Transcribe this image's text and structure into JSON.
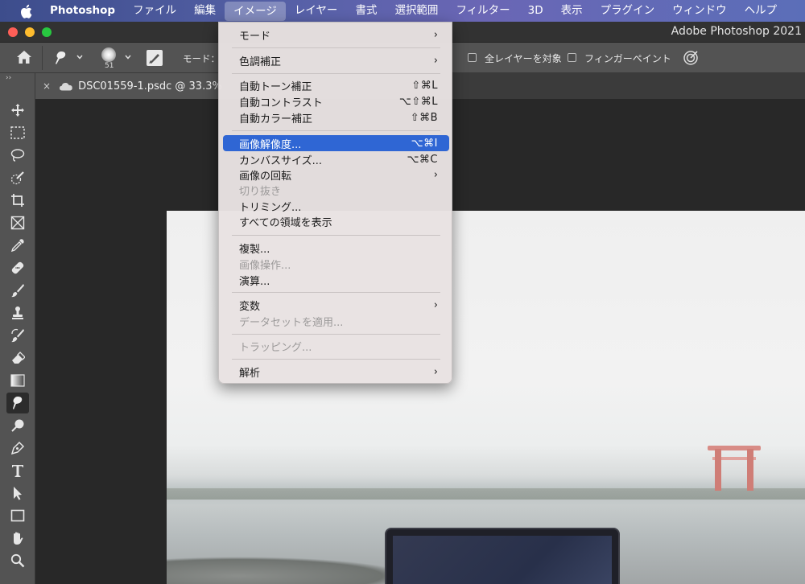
{
  "menubar": {
    "app": "Photoshop",
    "items": [
      "ファイル",
      "編集",
      "イメージ",
      "レイヤー",
      "書式",
      "選択範囲",
      "フィルター",
      "3D",
      "表示",
      "プラグイン",
      "ウィンドウ",
      "ヘルプ"
    ]
  },
  "window": {
    "title": "Adobe Photoshop 2021"
  },
  "options": {
    "brush_size": "51",
    "mode_label": "モード：",
    "all_layers_label": "全レイヤーを対象",
    "finger_paint_label": "フィンガーペイント"
  },
  "tab": {
    "title": "DSC01559-1.psdc @ 33.3%"
  },
  "toolbar": {
    "tools": [
      "move-tool",
      "marquee-tool",
      "lasso-tool",
      "quick-select-tool",
      "crop-tool",
      "frame-tool",
      "eyedropper-tool",
      "healing-brush-tool",
      "brush-tool",
      "clone-stamp-tool",
      "history-brush-tool",
      "eraser-tool",
      "gradient-tool",
      "smudge-tool",
      "dodge-tool",
      "pen-tool",
      "type-tool",
      "path-select-tool",
      "rectangle-tool",
      "hand-tool",
      "zoom-tool"
    ],
    "active": "smudge-tool"
  },
  "menu": {
    "items": [
      {
        "label": "モード",
        "shortcut": "",
        "submenu": true,
        "disabled": false
      },
      {
        "label": "色調補正",
        "shortcut": "",
        "submenu": true,
        "disabled": false
      },
      {
        "label": "自動トーン補正",
        "shortcut": "⇧⌘L",
        "submenu": false,
        "disabled": false
      },
      {
        "label": "自動コントラスト",
        "shortcut": "⌥⇧⌘L",
        "submenu": false,
        "disabled": false
      },
      {
        "label": "自動カラー補正",
        "shortcut": "⇧⌘B",
        "submenu": false,
        "disabled": false
      },
      {
        "label": "画像解像度...",
        "shortcut": "⌥⌘I",
        "submenu": false,
        "disabled": false,
        "highlighted": true
      },
      {
        "label": "カンバスサイズ...",
        "shortcut": "⌥⌘C",
        "submenu": false,
        "disabled": false
      },
      {
        "label": "画像の回転",
        "shortcut": "",
        "submenu": true,
        "disabled": false
      },
      {
        "label": "切り抜き",
        "shortcut": "",
        "submenu": false,
        "disabled": true
      },
      {
        "label": "トリミング...",
        "shortcut": "",
        "submenu": false,
        "disabled": false
      },
      {
        "label": "すべての領域を表示",
        "shortcut": "",
        "submenu": false,
        "disabled": false
      },
      {
        "label": "複製...",
        "shortcut": "",
        "submenu": false,
        "disabled": false
      },
      {
        "label": "画像操作...",
        "shortcut": "",
        "submenu": false,
        "disabled": true
      },
      {
        "label": "演算...",
        "shortcut": "",
        "submenu": false,
        "disabled": false
      },
      {
        "label": "変数",
        "shortcut": "",
        "submenu": true,
        "disabled": false
      },
      {
        "label": "データセットを適用...",
        "shortcut": "",
        "submenu": false,
        "disabled": true
      },
      {
        "label": "トラッピング...",
        "shortcut": "",
        "submenu": false,
        "disabled": true
      },
      {
        "label": "解析",
        "shortcut": "",
        "submenu": true,
        "disabled": false
      }
    ],
    "submenu_arrow": "›"
  }
}
